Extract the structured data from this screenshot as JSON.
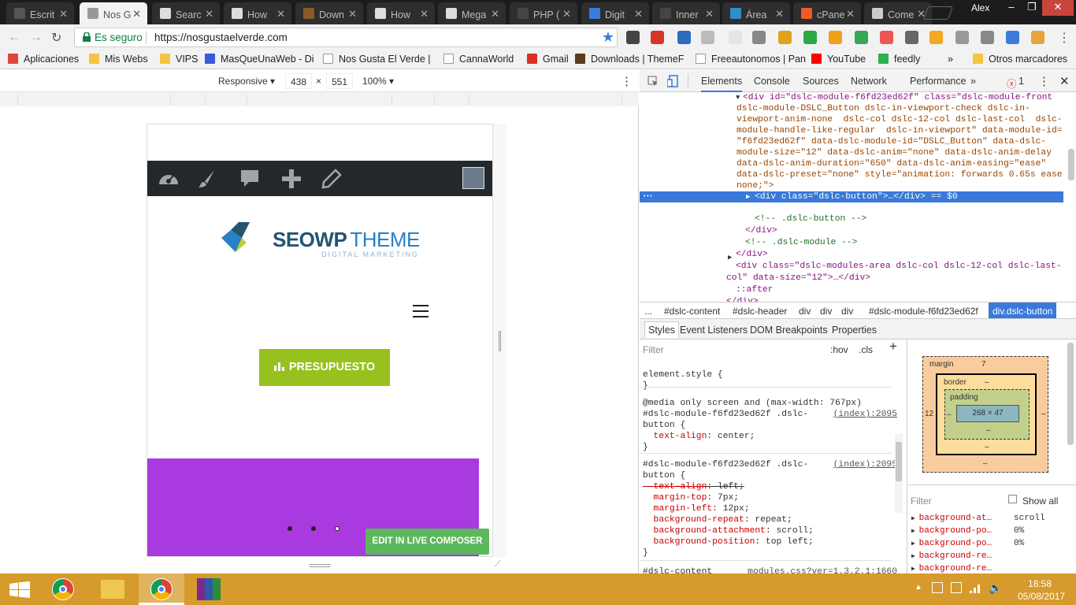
{
  "browser": {
    "tabs": [
      {
        "label": "Escrit",
        "color": "#555"
      },
      {
        "label": "Nos G",
        "color": "#999",
        "active": true
      },
      {
        "label": "Searc",
        "color": "#ddd"
      },
      {
        "label": "How",
        "color": "#ddd"
      },
      {
        "label": "Down",
        "color": "#8a5a2b"
      },
      {
        "label": "How",
        "color": "#ddd"
      },
      {
        "label": "Mega",
        "color": "#ddd"
      },
      {
        "label": "PHP (",
        "color": "#444"
      },
      {
        "label": "Digit",
        "color": "#3b7ddd"
      },
      {
        "label": "Inner",
        "color": "#444"
      },
      {
        "label": "Área",
        "color": "#2c8fc9"
      },
      {
        "label": "cPane",
        "color": "#f05a28"
      },
      {
        "label": "Come",
        "color": "#ccc"
      }
    ],
    "user": "Alex",
    "secure_label": "Es seguro",
    "url": "https://nosgustaelverde.com",
    "bookmarks": [
      {
        "label": "Aplicaciones",
        "icon": "apps-icon"
      },
      {
        "label": "Mis Webs",
        "icon": "folder-icon"
      },
      {
        "label": "VIPS",
        "icon": "folder-icon"
      },
      {
        "label": "MasQueUnaWeb - Di",
        "icon": "puzzle-icon"
      },
      {
        "label": "Nos Gusta El Verde |",
        "icon": "page-icon"
      },
      {
        "label": "CannaWorld",
        "icon": "page-icon"
      },
      {
        "label": "Gmail",
        "icon": "gmail-icon"
      },
      {
        "label": "Downloads | ThemeF",
        "icon": "themeforest-icon"
      },
      {
        "label": "Freeautonomos | Pan",
        "icon": "page-icon"
      },
      {
        "label": "YouTube",
        "icon": "youtube-icon"
      },
      {
        "label": "feedly",
        "icon": "feedly-icon"
      }
    ],
    "bookmarks_more": "»",
    "other_bookmarks": "Otros marcadores"
  },
  "device": {
    "mode": "Responsive",
    "width": "438",
    "times": "×",
    "height": "551",
    "zoom": "100%"
  },
  "page": {
    "logo_main_a": "SEO",
    "logo_main_b": "WP",
    "logo_main_c": "THEME",
    "logo_sub": "DIGITAL MARKETING",
    "cta": "PRESUPUESTO",
    "composer": "EDIT IN LIVE COMPOSER"
  },
  "devtools": {
    "tabs": [
      "Elements",
      "Console",
      "Sources",
      "Network",
      "Performance"
    ],
    "more": "»",
    "errors": "1",
    "dom_lines": [
      "<div id=\"dslc-module-f6fd23ed62f\" class=\"dslc-module-front",
      "dslc-module-DSLC_Button dslc-in-viewport-check dslc-in-",
      "viewport-anim-none  dslc-col dslc-12-col dslc-last-col  dslc-",
      "module-handle-like-regular  dslc-in-viewport\" data-module-id=",
      "\"f6fd23ed62f\" data-dslc-module-id=\"DSLC_Button\" data-dslc-",
      "module-size=\"12\" data-dslc-anim=\"none\" data-dslc-anim-delay",
      "data-dslc-anim-duration=\"650\" data-dslc-anim-easing=\"ease\"",
      "data-dslc-preset=\"none\" style=\"animation: forwards 0.65s ease",
      "none;\">"
    ],
    "selected_line": "<div class=\"dslc-button\">…</div> == $0",
    "dom_after": [
      "<!-- .dslc-button -->",
      "</div>",
      "<!-- .dslc-module -->",
      "</div>",
      "<div class=\"dslc-modules-area dslc-col dslc-12-col dslc-last-",
      "col\" data-size=\"12\">…</div>",
      "::after",
      "</div>",
      "</div>"
    ],
    "breadcrumbs": [
      "...",
      "#dslc-content",
      "#dslc-header",
      "div",
      "div",
      "div",
      "#dslc-module-f6fd23ed62f",
      "div.dslc-button"
    ],
    "subtabs": [
      "Styles",
      "Event Listeners",
      "DOM Breakpoints",
      "Properties"
    ],
    "filter": "Filter",
    "hov": ":hov",
    "cls": ".cls",
    "plus": "+",
    "styles_lines": [
      "element.style {",
      "}",
      "@media only screen and (max-width: 767px)",
      "#dslc-module-f6fd23ed62f .dslc-",
      "button {",
      "  text-align: center;",
      "}",
      "#dslc-module-f6fd23ed62f .dslc-",
      "button {",
      "  text-align: left;",
      "  margin-top: 7px;",
      "  margin-left: 12px;",
      "  background-repeat: repeat;",
      "  background-attachment: scroll;",
      "  background-position: top left;",
      "}",
      "#dslc-content"
    ],
    "src1": "(index):2095",
    "src2": "(index):2095",
    "src3": "modules.css?ver=1.3.2.1:1660",
    "box": {
      "margin": "margin",
      "margin_top": "7",
      "margin_left": "12",
      "border": "border",
      "padding": "padding",
      "content": "268 × 47",
      "dash": "–"
    },
    "computed_filter": "Filter",
    "show_all": "Show all",
    "computed": [
      {
        "name": "background-at…",
        "value": "scroll"
      },
      {
        "name": "background-po…",
        "value": "0%"
      },
      {
        "name": "background-po…",
        "value": "0%"
      },
      {
        "name": "background-re…",
        "value": ""
      },
      {
        "name": "background-re…",
        "value": ""
      }
    ]
  },
  "taskbar": {
    "time": "18:58",
    "date": "05/08/2017"
  },
  "colors": {
    "admin": "#23282d",
    "cta": "#96c11f",
    "purple": "#a83adf",
    "composer": "#5cb85c",
    "taskbar": "#d69a2d",
    "selection": "#3879d9"
  }
}
